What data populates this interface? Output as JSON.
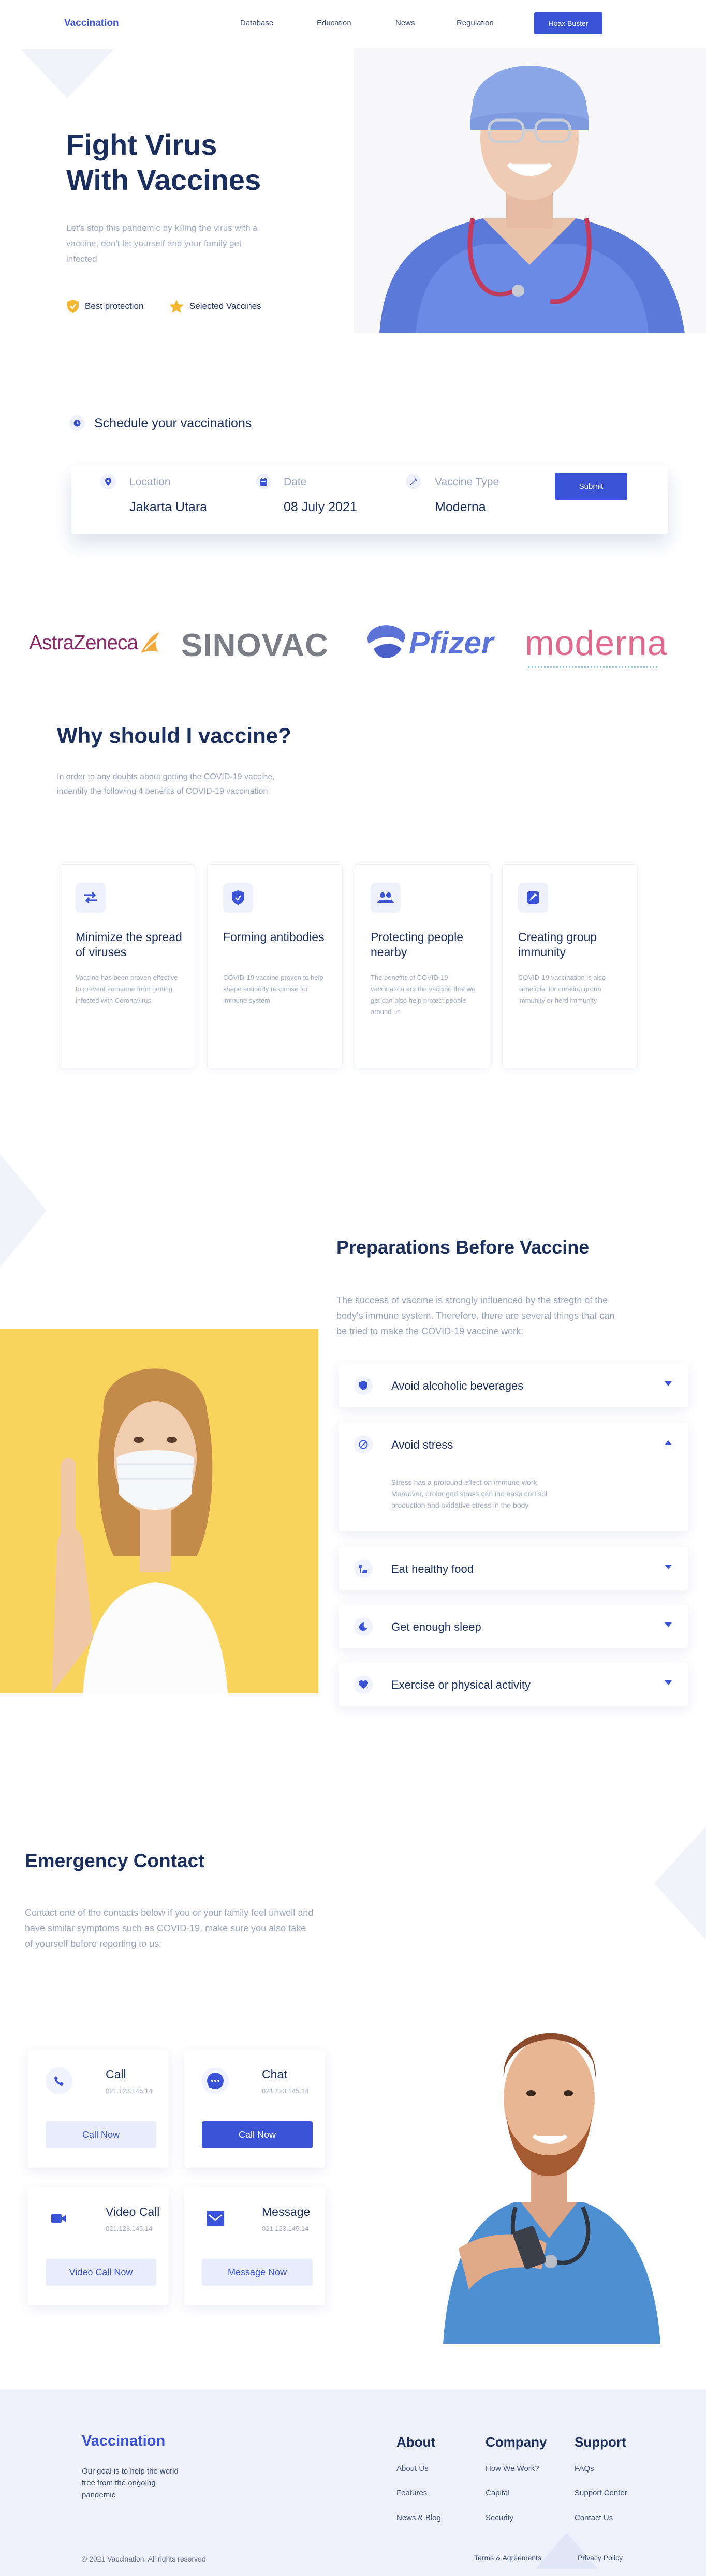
{
  "header": {
    "brand": "Vaccination",
    "nav": [
      "Database",
      "Education",
      "News",
      "Regulation"
    ],
    "cta": "Hoax Buster"
  },
  "hero": {
    "title_line1": "Fight Virus",
    "title_line2": "With Vaccines",
    "desc": "Let's stop this pandemic by killing the virus with a vaccine, don't let yourself and your family get infected",
    "badge1": "Best protection",
    "badge2": "Selected Vaccines"
  },
  "schedule": {
    "heading": "Schedule your vaccinations",
    "location_label": "Location",
    "location_value": "Jakarta Utara",
    "date_label": "Date",
    "date_value": "08 July 2021",
    "vaccine_label": "Vaccine Type",
    "vaccine_value": "Moderna",
    "submit": "Submit"
  },
  "partners": [
    "AstraZeneca",
    "SINOVAC",
    "Pfizer",
    "moderna"
  ],
  "why": {
    "title": "Why should I vaccine?",
    "desc": "In order to any doubts about getting the COVID-19 vaccine, indentify the following 4 benefits of COVID-19 vaccination:",
    "cards": [
      {
        "title": "Minimize the spread of viruses",
        "desc": "Vaccine has been proven effective to prevent someone from getting infected with Coronavirus",
        "icon": "arrows-icon"
      },
      {
        "title": "Forming antibodies",
        "desc": "COVID-19 vaccine proven to help shape antibody response for immune system",
        "icon": "shield-icon"
      },
      {
        "title": "Protecting people nearby",
        "desc": "The benefits of COVID-19 vaccination are the vaccine that we get can also help protect people around us",
        "icon": "people-icon"
      },
      {
        "title": "Creating group immunity",
        "desc": "COVID-19 vaccination is also beneficial for creating group immunity or herd immunity",
        "icon": "syringe-icon"
      }
    ]
  },
  "prep": {
    "title": "Preparations Before Vaccine",
    "desc": "The success of vaccine is strongly influenced by the stregth of the body's immune system. Therefore, there are several things that can be tried to make the COVID-19 vaccine work:",
    "items": [
      {
        "label": "Avoid alcoholic beverages",
        "icon": "shield-icon"
      },
      {
        "label": "Avoid stress",
        "icon": "no-icon",
        "detail": "Stress has a profound effect on immune work. Moreover, prolonged stress can increase cortisol production and oxidative stress in the body"
      },
      {
        "label": "Eat healthy food",
        "icon": "food-icon"
      },
      {
        "label": "Get enough sleep",
        "icon": "moon-icon"
      },
      {
        "label": "Exercise or physical activity",
        "icon": "heart-icon"
      }
    ]
  },
  "emergency": {
    "title": "Emergency Contact",
    "desc": "Contact one of the contacts below if you or your family feel unwell and have similar symptoms such as COVID-19, make sure you also take of yourself before reporting to us:",
    "cards": [
      {
        "name": "Call",
        "number": "021.123.145.14",
        "button": "Call Now",
        "icon": "phone-icon"
      },
      {
        "name": "Chat",
        "number": "021.123.145.14",
        "button": "Call Now",
        "icon": "chat-icon"
      },
      {
        "name": "Video Call",
        "number": "021.123.145.14",
        "button": "Video Call Now",
        "icon": "video-icon"
      },
      {
        "name": "Message",
        "number": "021.123.145.14",
        "button": "Message Now",
        "icon": "mail-icon"
      }
    ]
  },
  "footer": {
    "brand": "Vaccination",
    "tagline": "Our goal is to help the world free from the ongoing pandemic",
    "cols": [
      {
        "heading": "About",
        "links": [
          "About Us",
          "Features",
          "News & Blog"
        ]
      },
      {
        "heading": "Company",
        "links": [
          "How We Work?",
          "Capital",
          "Security"
        ]
      },
      {
        "heading": "Support",
        "links": [
          "FAQs",
          "Support Center",
          "Contact Us"
        ]
      }
    ],
    "copyright": "© 2021 Vaccination. All rights reserved",
    "terms": "Terms & Agreements",
    "privacy": "Privacy Policy"
  },
  "colors": {
    "primary": "#3a53d6",
    "navy": "#1b2f5e",
    "muted": "#9aa3bd",
    "footer_bg": "#eef1fc"
  }
}
